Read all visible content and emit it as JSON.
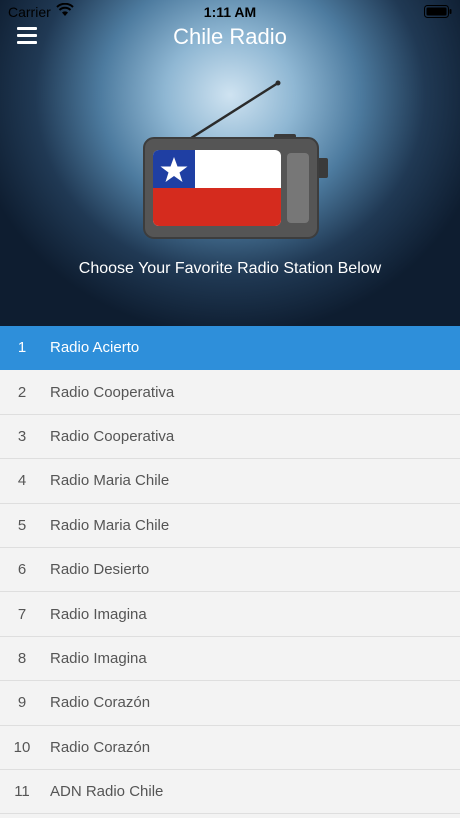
{
  "status_bar": {
    "carrier": "Carrier",
    "time": "1:11 AM"
  },
  "header": {
    "title": "Chile Radio",
    "menu_icon": "hamburger-menu-icon",
    "tagline": "Choose Your Favorite Radio Station Below"
  },
  "colors": {
    "accent": "#2e8fda",
    "flag_blue": "#1f3fa3",
    "flag_red": "#d52b1e",
    "flag_white": "#ffffff"
  },
  "stations": [
    {
      "number": "1",
      "name": "Radio Acierto",
      "selected": true
    },
    {
      "number": "2",
      "name": "Radio Cooperativa"
    },
    {
      "number": "3",
      "name": "Radio Cooperativa"
    },
    {
      "number": "4",
      "name": "Radio Maria Chile"
    },
    {
      "number": "5",
      "name": "Radio Maria Chile"
    },
    {
      "number": "6",
      "name": "Radio Desierto"
    },
    {
      "number": "7",
      "name": "Radio Imagina"
    },
    {
      "number": "8",
      "name": "Radio Imagina"
    },
    {
      "number": "9",
      "name": "Radio Corazón"
    },
    {
      "number": "10",
      "name": "Radio Corazón"
    },
    {
      "number": "11",
      "name": "ADN Radio Chile"
    }
  ]
}
